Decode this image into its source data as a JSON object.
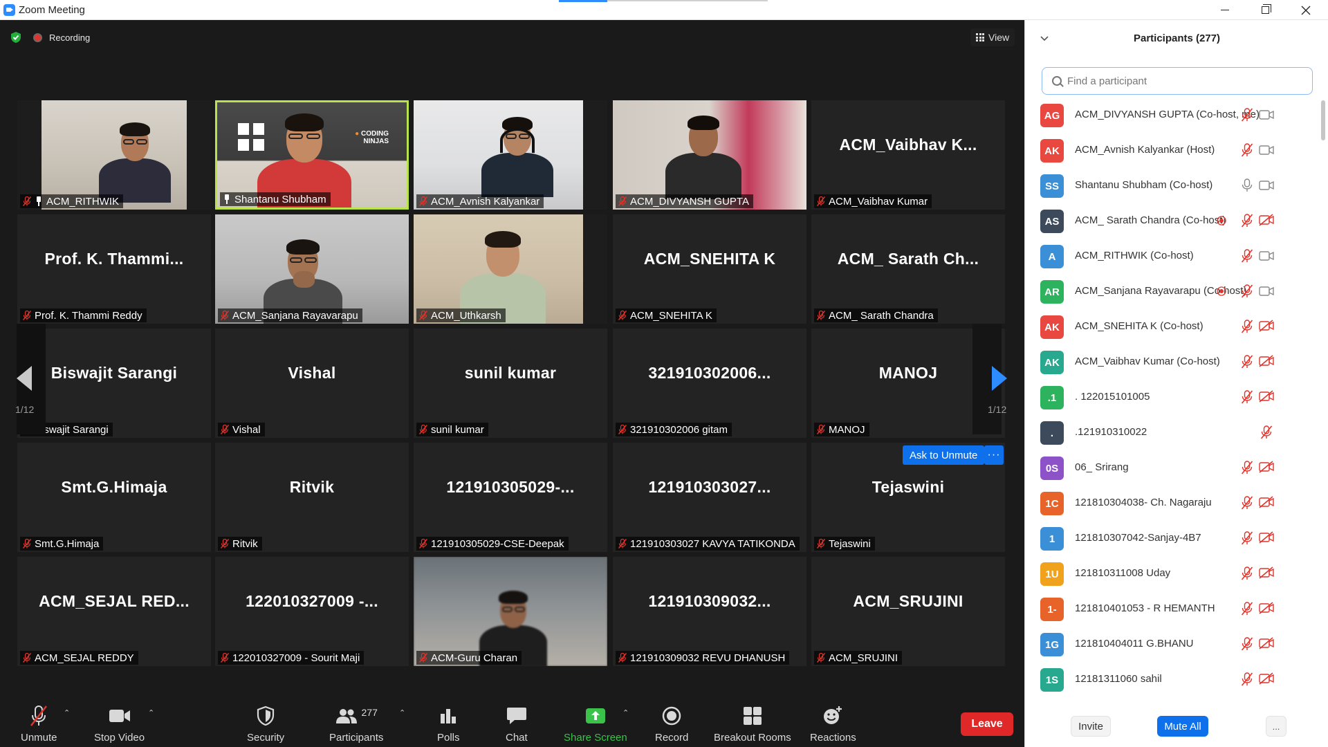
{
  "window": {
    "title": "Zoom Meeting"
  },
  "meeting": {
    "recording_label": "Recording",
    "view_label": "View",
    "page_indicator_left": "1/12",
    "page_indicator_right": "1/12",
    "ask_to_unmute": "Ask to Unmute",
    "more_label": "···"
  },
  "tiles": [
    {
      "name": "ACM_RITHWIK",
      "label": "ACM_RITHWIK",
      "video": true
    },
    {
      "name": "Shantanu Shubham",
      "label": "Shantanu Shubham",
      "video": true,
      "active": true
    },
    {
      "name": "ACM_Avnish Kalyankar",
      "label": "ACM_Avnish Kalyankar",
      "video": true
    },
    {
      "name": "ACM_DIVYANSH GUPTA",
      "label": "ACM_DIVYANSH GUPTA",
      "video": true
    },
    {
      "name": "ACM_Vaibhav  K...",
      "label": "ACM_Vaibhav Kumar",
      "video": false
    },
    {
      "name": "Prof. K. Thammi...",
      "label": "Prof. K. Thammi Reddy",
      "video": false
    },
    {
      "name": "ACM_Sanjana Rayavarapu",
      "label": "ACM_Sanjana Rayavarapu",
      "video": true
    },
    {
      "name": "ACM_Uthkarsh",
      "label": "ACM_Uthkarsh",
      "video": true
    },
    {
      "name": "ACM_SNEHITA K",
      "label": "ACM_SNEHITA K",
      "video": false
    },
    {
      "name": "ACM_ Sarath Ch...",
      "label": "ACM_ Sarath Chandra",
      "video": false
    },
    {
      "name": "Biswajit Sarangi",
      "label": "Biswajit Sarangi",
      "video": false
    },
    {
      "name": "Vishal",
      "label": "Vishal",
      "video": false
    },
    {
      "name": "sunil kumar",
      "label": "sunil kumar",
      "video": false
    },
    {
      "name": "321910302006...",
      "label": "321910302006 gitam",
      "video": false
    },
    {
      "name": "MANOJ",
      "label": "MANOJ",
      "video": false
    },
    {
      "name": "Smt.G.Himaja",
      "label": "Smt.G.Himaja",
      "video": false
    },
    {
      "name": "Ritvik",
      "label": "Ritvik",
      "video": false
    },
    {
      "name": "121910305029-...",
      "label": "121910305029-CSE-Deepak",
      "video": false
    },
    {
      "name": "121910303027...",
      "label": "121910303027 KAVYA TATIKONDA",
      "video": false
    },
    {
      "name": "Tejaswini",
      "label": "Tejaswini",
      "video": false
    },
    {
      "name": "ACM_SEJAL  RED...",
      "label": "ACM_SEJAL REDDY",
      "video": false
    },
    {
      "name": "122010327009  -...",
      "label": "122010327009 - Sourit Maji",
      "video": false
    },
    {
      "name": "ACM-Guru Charan",
      "label": "ACM-Guru Charan",
      "video": true
    },
    {
      "name": "121910309032...",
      "label": "121910309032 REVU DHANUSH",
      "video": false
    },
    {
      "name": "ACM_SRUJINI",
      "label": "ACM_SRUJINI",
      "video": false
    }
  ],
  "coding_ninjas_sign": "CODING NINJAS",
  "toolbar": {
    "unmute": "Unmute",
    "stop_video": "Stop Video",
    "security": "Security",
    "participants": "Participants",
    "participants_count": "277",
    "polls": "Polls",
    "chat": "Chat",
    "share_screen": "Share Screen",
    "record": "Record",
    "breakout_rooms": "Breakout Rooms",
    "reactions": "Reactions",
    "leave": "Leave"
  },
  "panel": {
    "title": "Participants (277)",
    "search_placeholder": "Find a participant",
    "invite": "Invite",
    "mute_all": "Mute All",
    "more": "...",
    "participants": [
      {
        "initials": "AG",
        "name": "ACM_DIVYANSH GUPTA (Co-host, me)",
        "color": "#e8483f",
        "mic": "muted",
        "cam": "on",
        "rec": false
      },
      {
        "initials": "AK",
        "name": "ACM_Avnish Kalyankar (Host)",
        "color": "#e8483f",
        "mic": "muted",
        "cam": "on",
        "rec": false
      },
      {
        "initials": "SS",
        "name": "Shantanu Shubham (Co-host)",
        "color": "#3a8fd6",
        "mic": "on",
        "cam": "on",
        "rec": false
      },
      {
        "initials": "AS",
        "name": "ACM_ Sarath Chandra (Co-host)",
        "color": "#3c4a5c",
        "mic": "muted",
        "cam": "off",
        "rec": true
      },
      {
        "initials": "A",
        "name": "ACM_RITHWIK (Co-host)",
        "color": "#3a8fd6",
        "mic": "muted",
        "cam": "on",
        "rec": false
      },
      {
        "initials": "AR",
        "name": "ACM_Sanjana Rayavarapu (Co-host)",
        "color": "#2db35d",
        "mic": "muted",
        "cam": "on",
        "rec": true
      },
      {
        "initials": "AK",
        "name": "ACM_SNEHITA K (Co-host)",
        "color": "#e8483f",
        "mic": "muted",
        "cam": "off",
        "rec": false
      },
      {
        "initials": "AK",
        "name": "ACM_Vaibhav Kumar (Co-host)",
        "color": "#27a88f",
        "mic": "muted",
        "cam": "off",
        "rec": false
      },
      {
        "initials": ".1",
        "name": ". 122015101005",
        "color": "#2db35d",
        "mic": "muted",
        "cam": "off",
        "rec": false
      },
      {
        "initials": ".",
        "name": ".121910310022",
        "color": "#3c4a5c",
        "mic": "muted",
        "cam": "none",
        "rec": false
      },
      {
        "initials": "0S",
        "name": "06_ Srirang",
        "color": "#8d52c7",
        "mic": "muted",
        "cam": "off",
        "rec": false
      },
      {
        "initials": "1C",
        "name": "121810304038- Ch. Nagaraju",
        "color": "#e8632a",
        "mic": "muted",
        "cam": "off",
        "rec": false
      },
      {
        "initials": "1",
        "name": "121810307042-Sanjay-4B7",
        "color": "#3a8fd6",
        "mic": "muted",
        "cam": "off",
        "rec": false
      },
      {
        "initials": "1U",
        "name": "121810311008 Uday",
        "color": "#f1a21c",
        "mic": "muted",
        "cam": "off",
        "rec": false
      },
      {
        "initials": "1-",
        "name": "121810401053 - R HEMANTH",
        "color": "#e8632a",
        "mic": "muted",
        "cam": "off",
        "rec": false
      },
      {
        "initials": "1G",
        "name": "121810404011 G.BHANU",
        "color": "#3a8fd6",
        "mic": "muted",
        "cam": "off",
        "rec": false
      },
      {
        "initials": "1S",
        "name": "12181311060 sahil",
        "color": "#27a88f",
        "mic": "muted",
        "cam": "off",
        "rec": false
      }
    ]
  },
  "colors": {
    "accent": "#0e71eb",
    "leave": "#e02828",
    "muted_red": "#e0342c",
    "active_speaker": "#b8e34a",
    "share_green": "#3ac24a"
  }
}
